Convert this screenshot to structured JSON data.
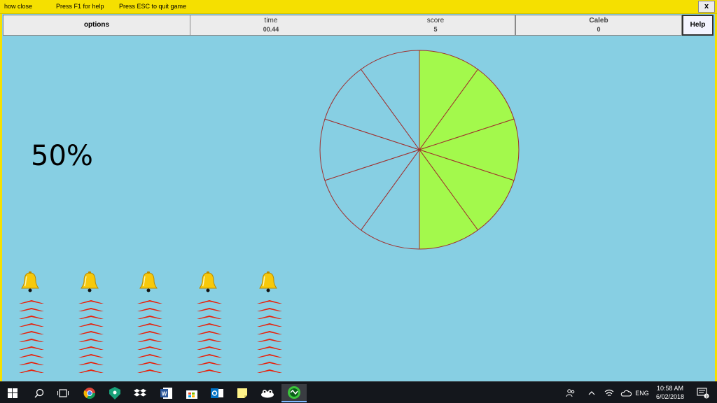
{
  "titlebar": {
    "hint1": "how close",
    "hint2": "Press F1 for help",
    "hint3": "Press ESC to quit game",
    "close_label": "x"
  },
  "panels": {
    "options_label": "options",
    "time_label": "time",
    "time_value": "00.44",
    "score_label": "score",
    "score_value": "5",
    "player_name": "Caleb",
    "player_score": "0",
    "help_label": "Help"
  },
  "game": {
    "percent_text": "50%",
    "pie_segments_total": 10,
    "pie_segments_filled": 5,
    "pie_fill_color": "#a3f94c",
    "pie_line_color": "#a0302e",
    "background_color": "#87cfe3",
    "bell_count": 5,
    "chevrons_per_column": 10,
    "chevron_color": "#e8200a"
  },
  "taskbar": {
    "items": [
      {
        "name": "start",
        "icon": "windows-logo-icon"
      },
      {
        "name": "search",
        "icon": "search-icon"
      },
      {
        "name": "task-view",
        "icon": "task-view-icon"
      },
      {
        "name": "chrome",
        "icon": "chrome-icon"
      },
      {
        "name": "keepass",
        "icon": "keepass-icon"
      },
      {
        "name": "dropbox",
        "icon": "dropbox-icon"
      },
      {
        "name": "word",
        "icon": "word-icon"
      },
      {
        "name": "store",
        "icon": "store-icon"
      },
      {
        "name": "outlook",
        "icon": "outlook-icon"
      },
      {
        "name": "sticky-notes",
        "icon": "sticky-notes-icon"
      },
      {
        "name": "game-app",
        "icon": "game-app-icon"
      },
      {
        "name": "active-game",
        "icon": "active-game-icon"
      }
    ],
    "tray_language": "ENG",
    "clock_time": "10:58 AM",
    "clock_date": "6/02/2018",
    "notification_count": "3"
  }
}
